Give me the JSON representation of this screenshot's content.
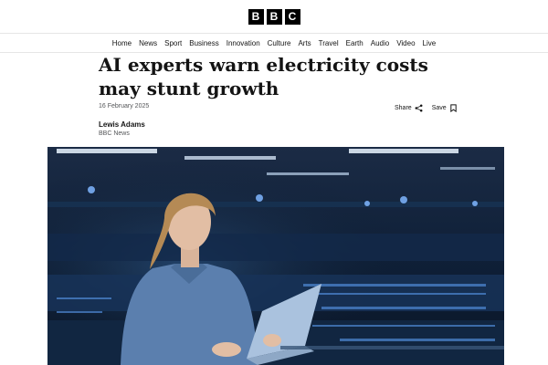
{
  "brand": {
    "letters": [
      "B",
      "B",
      "C"
    ]
  },
  "nav": {
    "items": [
      "Home",
      "News",
      "Sport",
      "Business",
      "Innovation",
      "Culture",
      "Arts",
      "Travel",
      "Earth",
      "Audio",
      "Video",
      "Live"
    ]
  },
  "article": {
    "headline": "AI experts warn electricity costs may stunt growth",
    "date": "16 February 2025",
    "author": "Lewis Adams",
    "organization": "BBC News",
    "share_label": "Share",
    "save_label": "Save"
  },
  "icons": {
    "share": "share-icon",
    "save": "bookmark-icon"
  },
  "colors": {
    "text": "#141414",
    "muted": "#545658",
    "brand_block": "#000000"
  }
}
